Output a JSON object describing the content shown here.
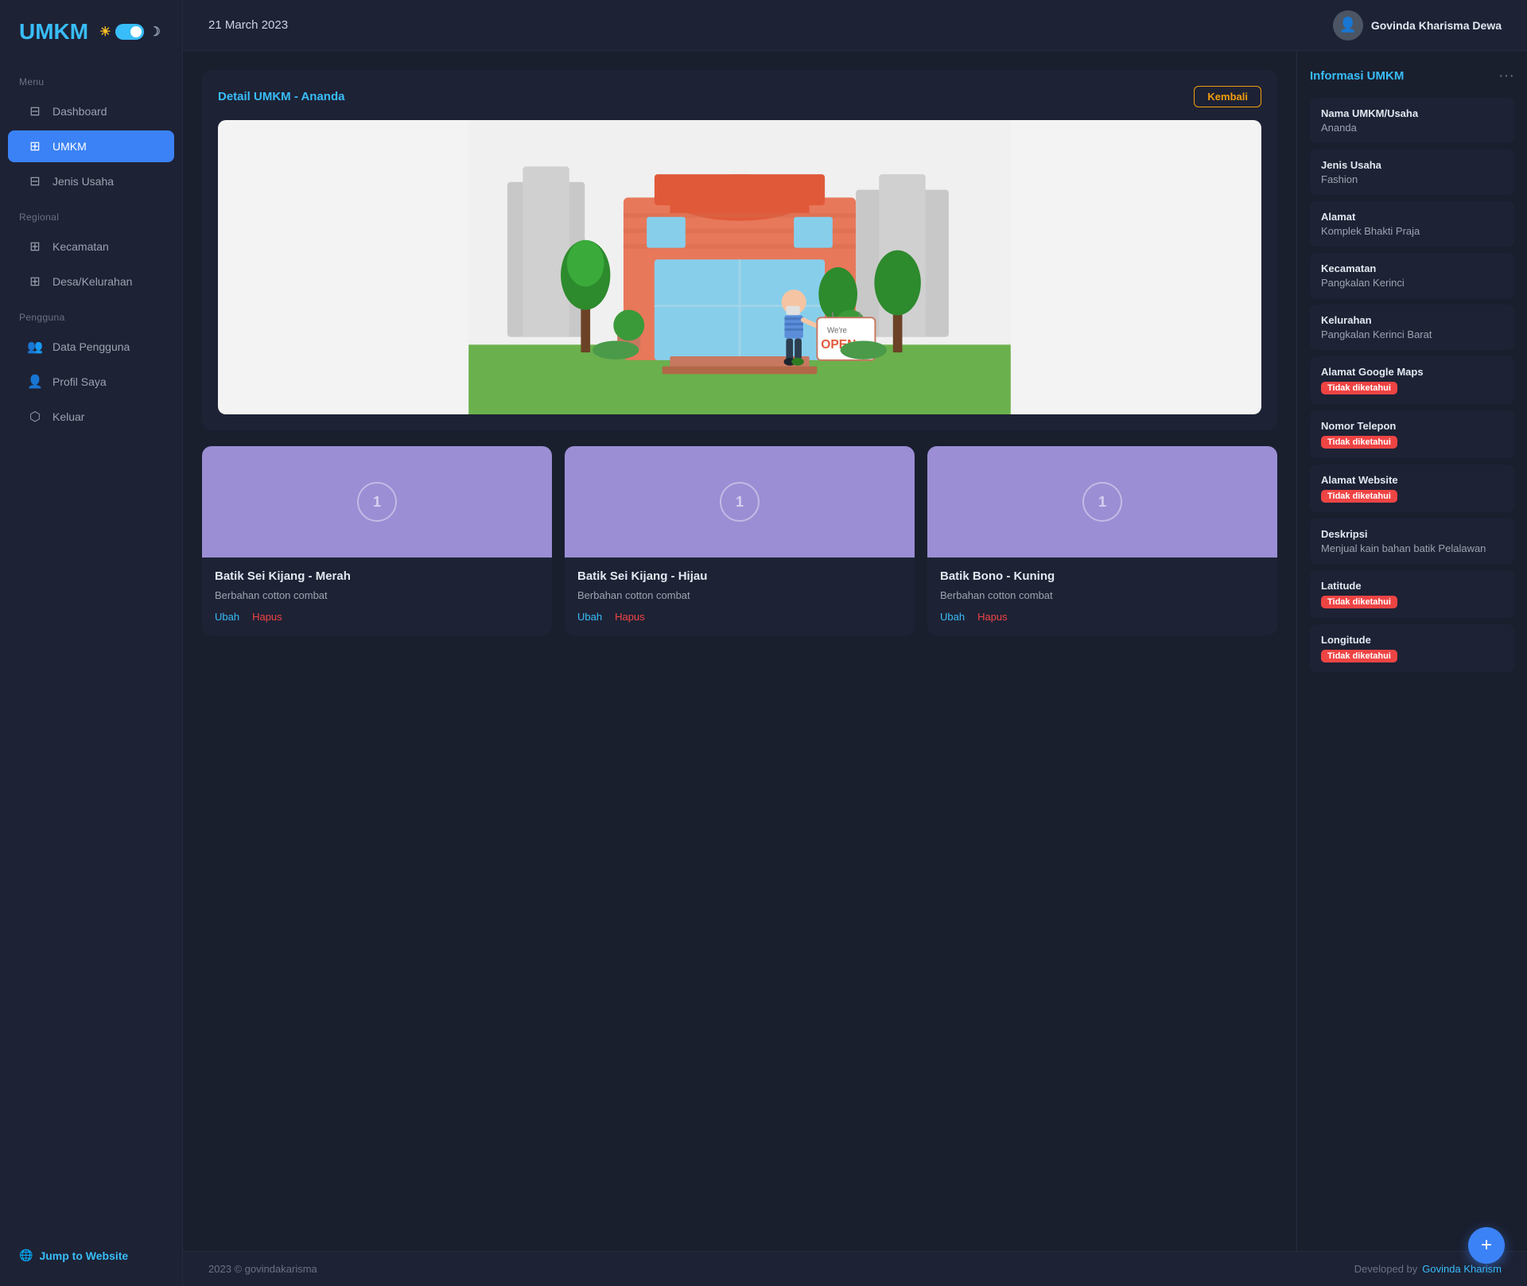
{
  "sidebar": {
    "logo": "UMKM",
    "menu_label": "Menu",
    "items": [
      {
        "id": "dashboard",
        "label": "Dashboard",
        "icon": "▦",
        "active": false
      },
      {
        "id": "umkm",
        "label": "UMKM",
        "icon": "⊞",
        "active": true
      }
    ],
    "jenis_usaha_label": "Jenis Usaha",
    "jenis_usaha_icon": "⊟",
    "regional_label": "Regional",
    "kecamatan_label": "Kecamatan",
    "kecamatan_icon": "⊞",
    "desa_label": "Desa/Kelurahan",
    "desa_icon": "⊞",
    "pengguna_label": "Pengguna",
    "data_pengguna_label": "Data Pengguna",
    "data_pengguna_icon": "👥",
    "profil_saya_label": "Profil Saya",
    "profil_saya_icon": "👤",
    "keluar_label": "Keluar",
    "keluar_icon": "⬡",
    "jump_to_website": "Jump to Website"
  },
  "topbar": {
    "date": "21 March 2023",
    "username": "Govinda Kharisma Dewa"
  },
  "detail": {
    "title": "Detail UMKM - Ananda",
    "kembali_label": "Kembali"
  },
  "info_panel": {
    "title": "Informasi UMKM",
    "dots": "···",
    "fields": [
      {
        "label": "Nama UMKM/Usaha",
        "value": "Ananda",
        "badge": false
      },
      {
        "label": "Jenis Usaha",
        "value": "Fashion",
        "badge": false
      },
      {
        "label": "Alamat",
        "value": "Komplek Bhakti Praja",
        "badge": false
      },
      {
        "label": "Kecamatan",
        "value": "Pangkalan Kerinci",
        "badge": false
      },
      {
        "label": "Kelurahan",
        "value": "Pangkalan Kerinci Barat",
        "badge": false
      },
      {
        "label": "Alamat Google Maps",
        "value": "Tidak diketahui",
        "badge": true
      },
      {
        "label": "Nomor Telepon",
        "value": "Tidak diketahui",
        "badge": true
      },
      {
        "label": "Alamat Website",
        "value": "Tidak diketahui",
        "badge": true
      },
      {
        "label": "Deskripsi",
        "value": "Menjual kain bahan batik Pelalawan",
        "badge": false
      },
      {
        "label": "Latitude",
        "value": "Tidak diketahui",
        "badge": true
      },
      {
        "label": "Longitude",
        "value": "Tidak diketahui",
        "badge": true
      }
    ]
  },
  "products": [
    {
      "num": "1",
      "name": "Batik Sei Kijang - Merah",
      "desc": "Berbahan cotton combat",
      "ubah": "Ubah",
      "hapus": "Hapus"
    },
    {
      "num": "1",
      "name": "Batik Sei Kijang - Hijau",
      "desc": "Berbahan cotton combat",
      "ubah": "Ubah",
      "hapus": "Hapus"
    },
    {
      "num": "1",
      "name": "Batik Bono - Kuning",
      "desc": "Berbahan cotton combat",
      "ubah": "Ubah",
      "hapus": "Hapus"
    }
  ],
  "footer": {
    "copyright": "2023 © govindakarisma",
    "developed_by": "Developed by",
    "dev_link": "Govinda Kharism"
  },
  "fab": "+"
}
